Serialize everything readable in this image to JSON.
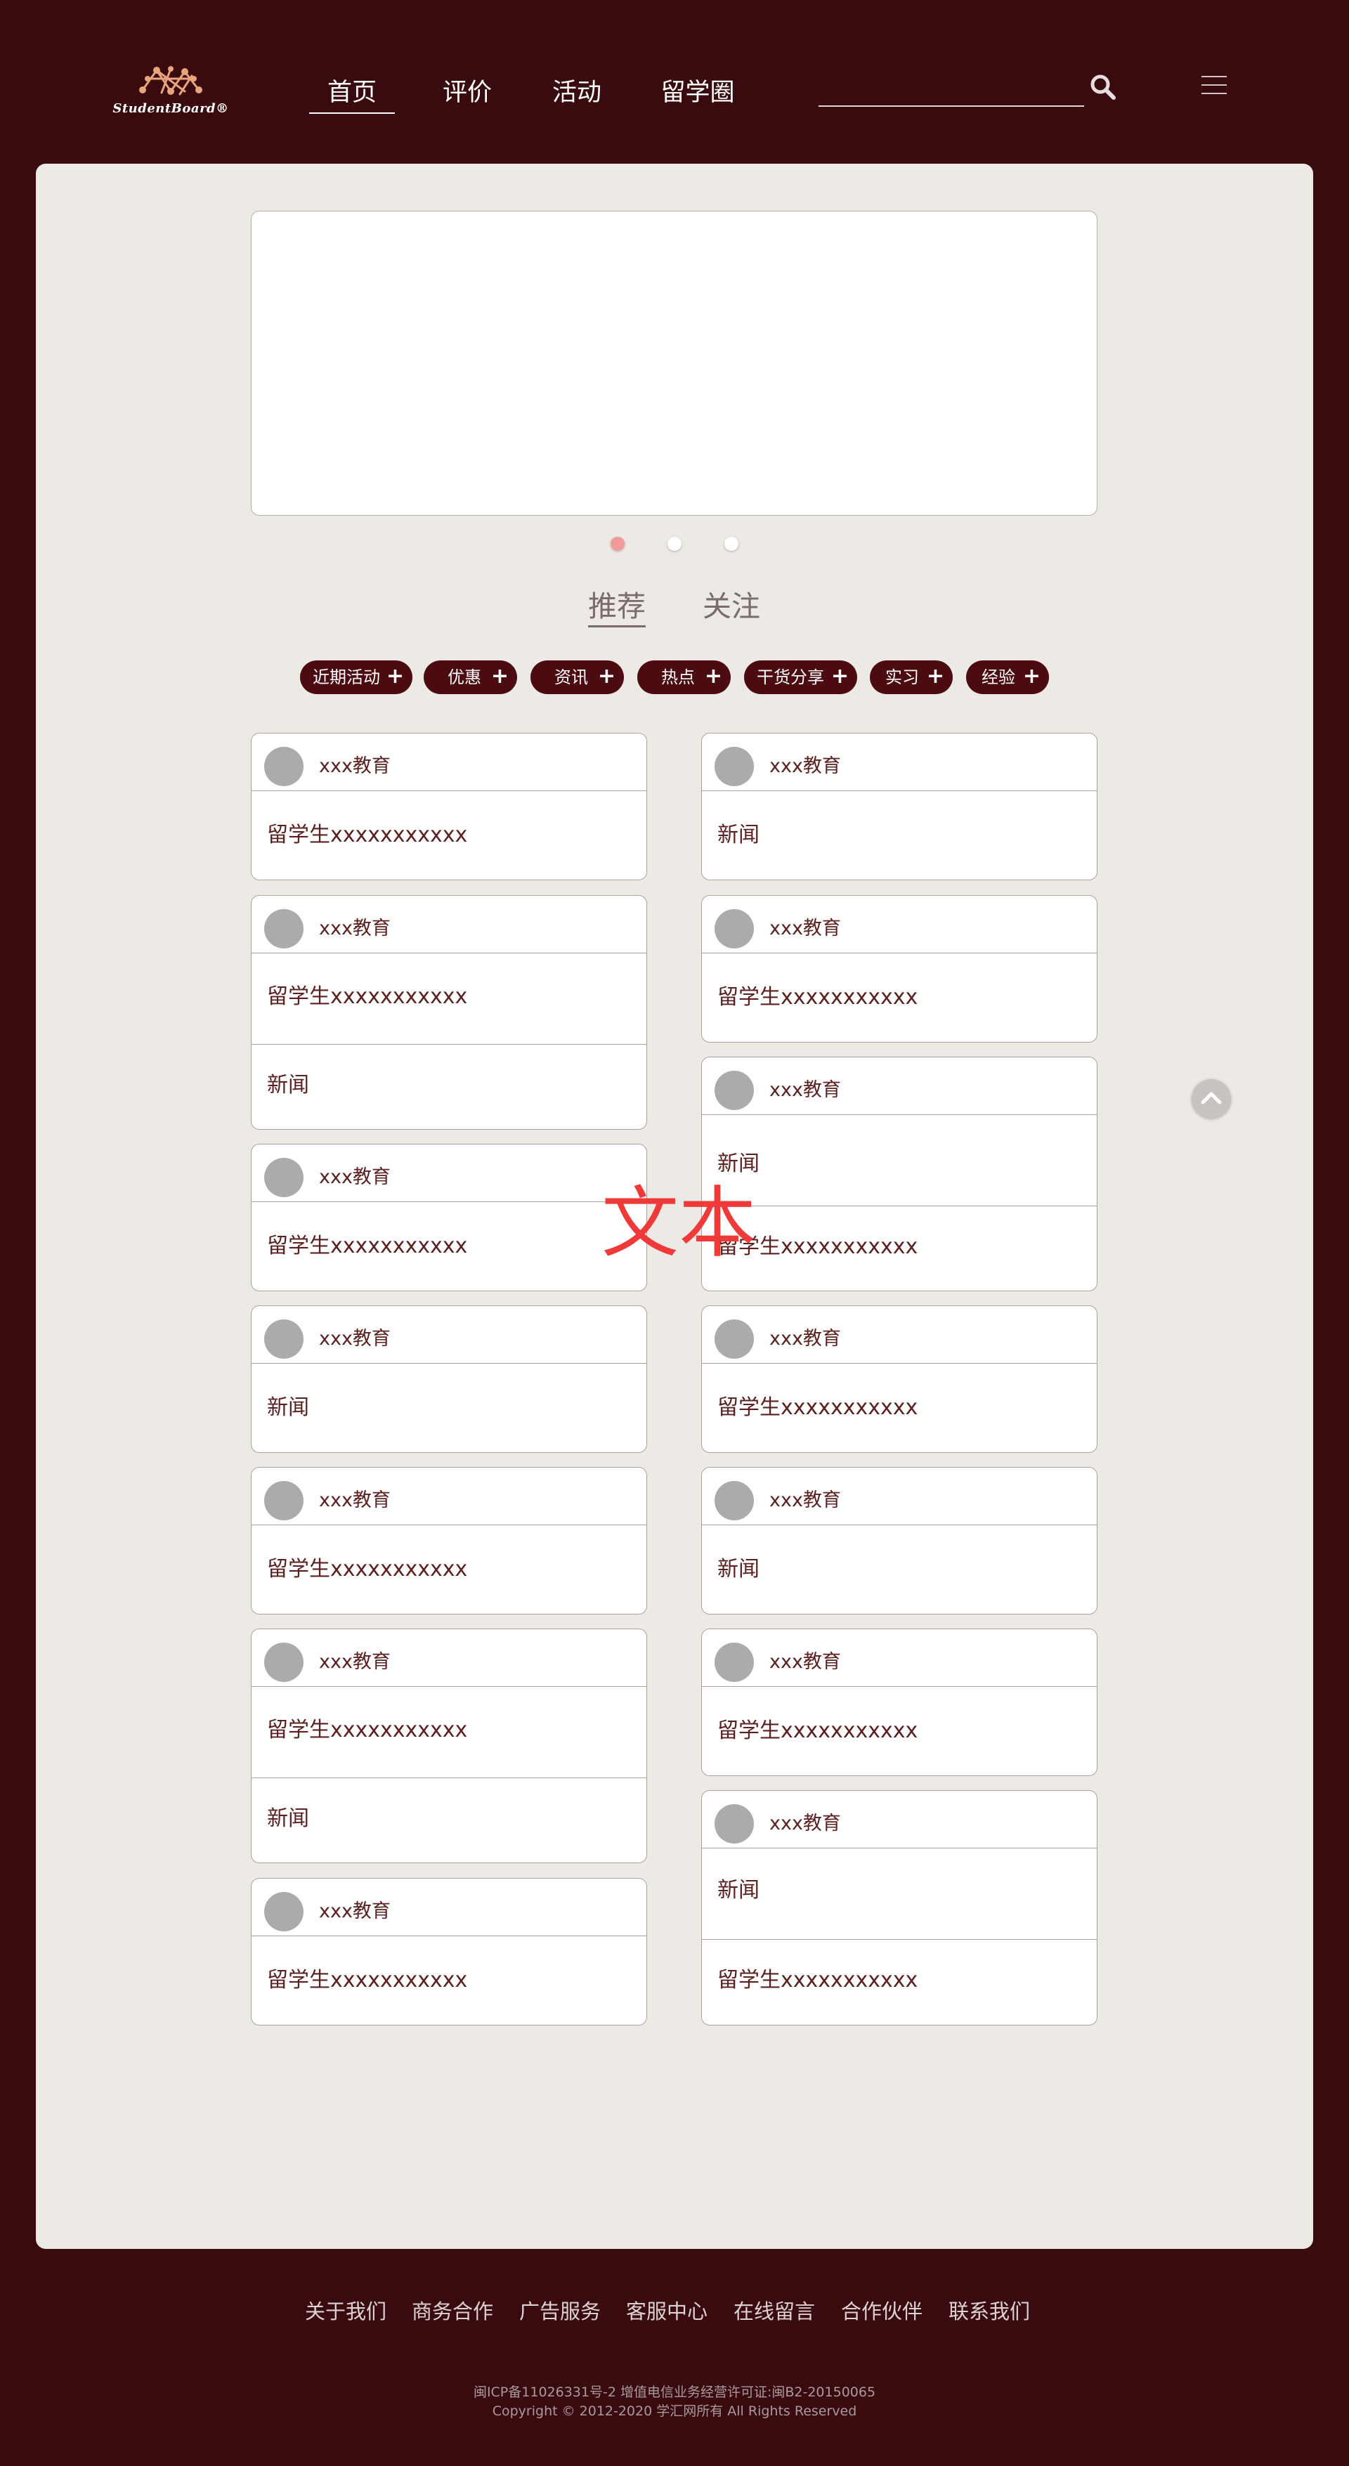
{
  "header": {
    "logo_text": "StudentBoard®",
    "nav": [
      {
        "label": "首页",
        "active": true
      },
      {
        "label": "评价",
        "active": false
      },
      {
        "label": "活动",
        "active": false
      },
      {
        "label": "留学圈",
        "active": false
      }
    ],
    "search": {
      "value": "",
      "placeholder": "",
      "icon": "search-icon"
    },
    "menu_icon": "hamburger-menu-icon"
  },
  "carousel": {
    "slide_count": 3,
    "active_index": 0
  },
  "tabs": [
    {
      "label": "推荐",
      "active": true
    },
    {
      "label": "关注",
      "active": false
    }
  ],
  "chips": [
    "近期活动",
    "优惠",
    "资讯",
    "热点",
    "干货分享",
    "实习",
    "经验"
  ],
  "feed": {
    "left": [
      {
        "org": "xxx教育",
        "rows": [
          "留学生xxxxxxxxxxx"
        ]
      },
      {
        "org": "xxx教育",
        "rows": [
          "留学生xxxxxxxxxxx",
          "新闻"
        ]
      },
      {
        "org": "xxx教育",
        "rows": [
          "留学生xxxxxxxxxxx"
        ]
      },
      {
        "org": "xxx教育",
        "rows": [
          "新闻"
        ]
      },
      {
        "org": "xxx教育",
        "rows": [
          "留学生xxxxxxxxxxx"
        ]
      },
      {
        "org": "xxx教育",
        "rows": [
          "留学生xxxxxxxxxxx",
          "新闻"
        ]
      },
      {
        "org": "xxx教育",
        "rows": [
          "留学生xxxxxxxxxxx"
        ]
      }
    ],
    "right": [
      {
        "org": "xxx教育",
        "rows": [
          "新闻"
        ]
      },
      {
        "org": "xxx教育",
        "rows": [
          "留学生xxxxxxxxxxx"
        ]
      },
      {
        "org": "xxx教育",
        "rows": [
          "新闻",
          "留学生xxxxxxxxxxx"
        ]
      },
      {
        "org": "xxx教育",
        "rows": [
          "留学生xxxxxxxxxxx"
        ]
      },
      {
        "org": "xxx教育",
        "rows": [
          "新闻"
        ]
      },
      {
        "org": "xxx教育",
        "rows": [
          "留学生xxxxxxxxxxx"
        ]
      },
      {
        "org": "xxx教育",
        "rows": [
          "新闻",
          "留学生xxxxxxxxxxx"
        ]
      }
    ]
  },
  "overlay_text": "文本",
  "back_to_top_icon": "chevron-up-icon",
  "footer": {
    "links": [
      "关于我们",
      "商务合作",
      "广告服务",
      "客服中心",
      "在线留言",
      "合作伙伴",
      "联系我们"
    ],
    "line1": "闽ICP备11026331号-2 增值电信业务经营许可证:闽B2-20150065",
    "line2": "Copyright © 2012-2020 学汇网所有 All Rights Reserved"
  },
  "colors": {
    "background": "#3a0b0e",
    "panel": "#ede9e5",
    "chip": "#4b0b11",
    "active_dot": "#f29a9a",
    "overlay_text": "#f03a3a"
  }
}
